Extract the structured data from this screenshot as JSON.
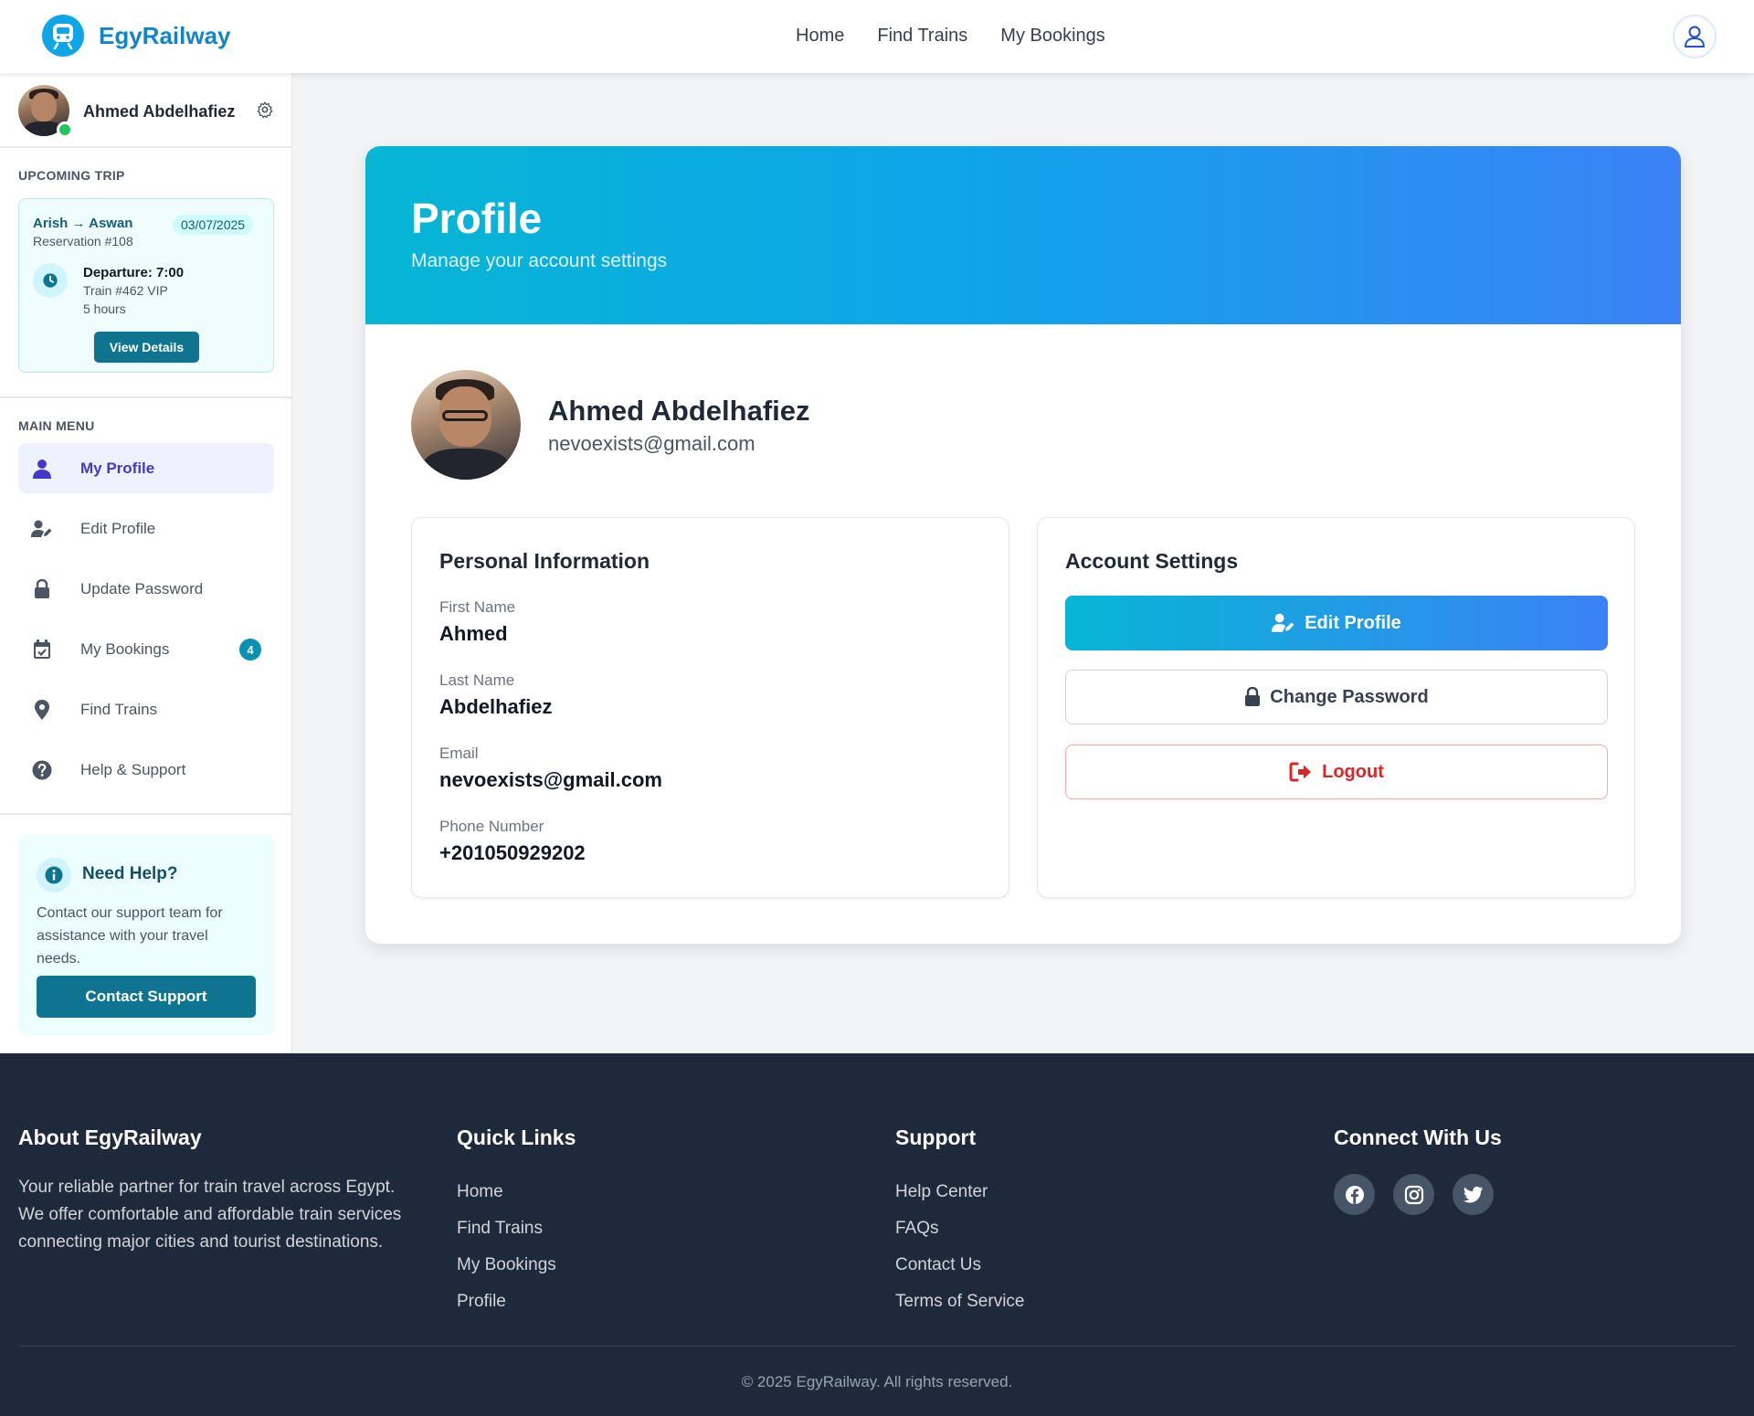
{
  "header": {
    "brand": "EgyRailway",
    "nav": [
      "Home",
      "Find Trains",
      "My Bookings"
    ]
  },
  "sidebar": {
    "user_name": "Ahmed Abdelhafiez",
    "upcoming_label": "UPCOMING TRIP",
    "trip": {
      "route": "Arish → Aswan",
      "reservation": "Reservation #108",
      "date": "03/07/2025",
      "departure": "Departure: 7:00",
      "train": "Train #462 VIP",
      "duration": "5 hours",
      "view_button": "View Details"
    },
    "menu_label": "MAIN MENU",
    "menu": [
      {
        "label": "My Profile",
        "icon": "user-icon"
      },
      {
        "label": "Edit Profile",
        "icon": "user-edit-icon"
      },
      {
        "label": "Update Password",
        "icon": "lock-icon"
      },
      {
        "label": "My Bookings",
        "icon": "calendar-check-icon",
        "badge": "4"
      },
      {
        "label": "Find Trains",
        "icon": "map-pin-icon"
      },
      {
        "label": "Help & Support",
        "icon": "question-circle-icon"
      }
    ],
    "help": {
      "title": "Need Help?",
      "text": "Contact our support team for assistance with your travel needs.",
      "button": "Contact Support"
    }
  },
  "profile": {
    "title": "Profile",
    "subtitle": "Manage your account settings",
    "name": "Ahmed Abdelhafiez",
    "email": "nevoexists@gmail.com",
    "personal_title": "Personal Information",
    "fields": [
      {
        "label": "First Name",
        "value": "Ahmed"
      },
      {
        "label": "Last Name",
        "value": "Abdelhafiez"
      },
      {
        "label": "Email",
        "value": "nevoexists@gmail.com"
      },
      {
        "label": "Phone Number",
        "value": "+201050929202"
      }
    ],
    "settings_title": "Account Settings",
    "edit_button": "Edit Profile",
    "password_button": "Change Password",
    "logout_button": "Logout"
  },
  "footer": {
    "about_title": "About EgyRailway",
    "about_text": "Your reliable partner for train travel across Egypt. We offer comfortable and affordable train services connecting major cities and tourist destinations.",
    "quick_title": "Quick Links",
    "quick_links": [
      "Home",
      "Find Trains",
      "My Bookings",
      "Profile"
    ],
    "support_title": "Support",
    "support_links": [
      "Help Center",
      "FAQs",
      "Contact Us",
      "Terms of Service"
    ],
    "connect_title": "Connect With Us",
    "social": [
      "facebook-icon",
      "instagram-icon",
      "twitter-icon"
    ],
    "copyright": "© 2025 EgyRailway. All rights reserved."
  },
  "colors": {
    "brand": "#1284c9",
    "accent": "#0e7490",
    "active_menu": "#4338ca",
    "gradient_start": "#06b6d4",
    "gradient_end": "#3b82f6",
    "logout": "#dc2626",
    "footer_bg": "#1e293b"
  }
}
